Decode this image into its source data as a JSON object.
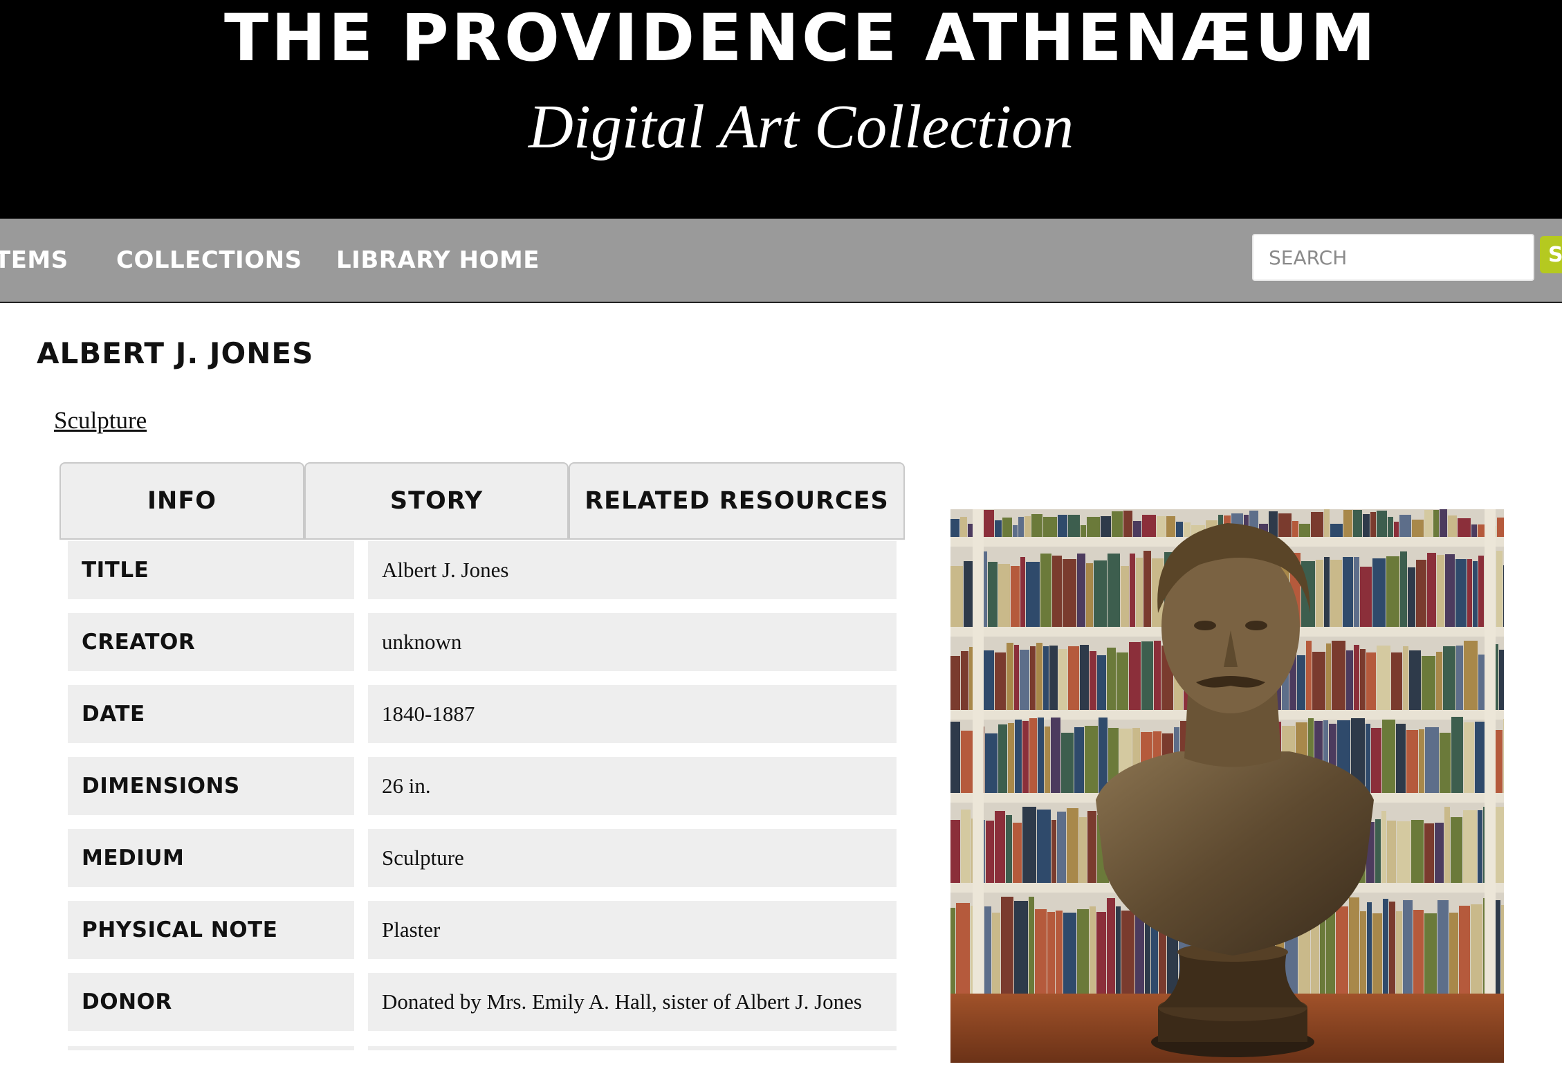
{
  "header": {
    "title": "THE PROVIDENCE ATHENÆUM",
    "subtitle": "Digital Art Collection"
  },
  "nav": {
    "items_label": "TEMS",
    "collections_label": "COLLECTIONS",
    "library_home_label": "LIBRARY HOME",
    "search_placeholder": "SEARCH",
    "search_button_label": "S"
  },
  "item": {
    "title": "ALBERT J. JONES",
    "type_link": "Sculpture"
  },
  "tabs": [
    {
      "label": "INFO"
    },
    {
      "label": "STORY"
    },
    {
      "label": "RELATED RESOURCES"
    }
  ],
  "metadata": [
    {
      "label": "TITLE",
      "value": "Albert J. Jones"
    },
    {
      "label": "CREATOR",
      "value": "unknown"
    },
    {
      "label": "DATE",
      "value": "1840-1887"
    },
    {
      "label": "DIMENSIONS",
      "value": "26 in."
    },
    {
      "label": "MEDIUM",
      "value": "Sculpture"
    },
    {
      "label": "PHYSICAL NOTE",
      "value": "Plaster"
    },
    {
      "label": "DONOR",
      "value": "Donated by Mrs. Emily A. Hall, sister of Albert J. Jones"
    }
  ],
  "colors": {
    "header_bg": "#000000",
    "nav_bg": "#9a9a9a",
    "search_button": "#b5c920",
    "cell_bg": "#eeeeee"
  }
}
